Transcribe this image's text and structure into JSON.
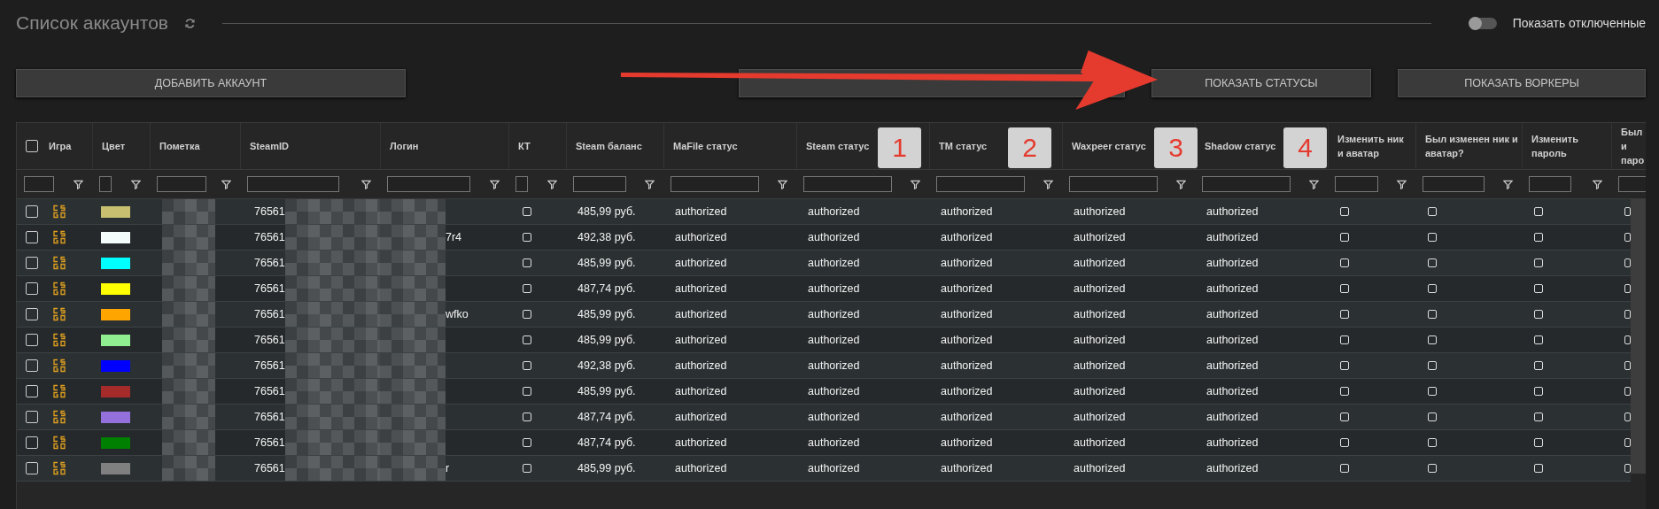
{
  "header": {
    "title": "Список аккаунтов",
    "toggle": {
      "label": "Показать отключенные",
      "on": false
    }
  },
  "buttons": [
    {
      "kind": "text",
      "label": "ДОБАВИТЬ АККАУНТ"
    },
    {
      "kind": "blank"
    },
    {
      "kind": "text",
      "label": "ПОКАЗАТЬ СТАТУСЫ"
    },
    {
      "kind": "text",
      "label": "ПОКАЗАТЬ ВОРКЕРЫ"
    }
  ],
  "table": {
    "all_selected": false,
    "columns": [
      "Игра",
      "Цвет",
      "Пометка",
      "SteamID",
      "Логин",
      "КТ",
      "Steam баланс",
      "MaFile статус",
      "Steam статус",
      "TM статус",
      "Waxpeer статус",
      "Shadow статус",
      "Изменить ник и аватар",
      "Был изменен ник и аватар?",
      "Изменить пароль",
      "Был и паро"
    ],
    "rows": [
      {
        "selected": false,
        "color": "#c8c070",
        "steamid": "76561",
        "kt": false,
        "balance": "485,99 руб.",
        "statuses": [
          "authorized",
          "authorized",
          "authorized",
          "authorized",
          "authorized"
        ],
        "flags": [
          false,
          false,
          false,
          false
        ]
      },
      {
        "selected": false,
        "color": "#f4fbfb",
        "steamid": "76561",
        "login": "7r4",
        "kt": false,
        "balance": "492,38 руб.",
        "statuses": [
          "authorized",
          "authorized",
          "authorized",
          "authorized",
          "authorized"
        ],
        "flags": [
          false,
          false,
          false,
          false
        ]
      },
      {
        "selected": false,
        "color": "#00ffff",
        "steamid": "76561",
        "kt": false,
        "balance": "485,99 руб.",
        "statuses": [
          "authorized",
          "authorized",
          "authorized",
          "authorized",
          "authorized"
        ],
        "flags": [
          false,
          false,
          false,
          false
        ]
      },
      {
        "selected": false,
        "color": "#ffff00",
        "steamid": "76561",
        "kt": false,
        "balance": "487,74 руб.",
        "statuses": [
          "authorized",
          "authorized",
          "authorized",
          "authorized",
          "authorized"
        ],
        "flags": [
          false,
          false,
          false,
          false
        ]
      },
      {
        "selected": false,
        "color": "#ffa500",
        "steamid": "76561",
        "login": "wfko",
        "kt": false,
        "balance": "485,99 руб.",
        "statuses": [
          "authorized",
          "authorized",
          "authorized",
          "authorized",
          "authorized"
        ],
        "flags": [
          false,
          false,
          false,
          false
        ]
      },
      {
        "selected": false,
        "color": "#90ee90",
        "steamid": "76561",
        "kt": false,
        "balance": "485,99 руб.",
        "statuses": [
          "authorized",
          "authorized",
          "authorized",
          "authorized",
          "authorized"
        ],
        "flags": [
          false,
          false,
          false,
          false
        ]
      },
      {
        "selected": false,
        "color": "#0000ff",
        "steamid": "76561",
        "kt": false,
        "balance": "492,38 руб.",
        "statuses": [
          "authorized",
          "authorized",
          "authorized",
          "authorized",
          "authorized"
        ],
        "flags": [
          false,
          false,
          false,
          false
        ]
      },
      {
        "selected": false,
        "color": "#a52a2a",
        "steamid": "76561",
        "kt": false,
        "balance": "485,99 руб.",
        "statuses": [
          "authorized",
          "authorized",
          "authorized",
          "authorized",
          "authorized"
        ],
        "flags": [
          false,
          false,
          false,
          false
        ]
      },
      {
        "selected": false,
        "color": "#9370db",
        "steamid": "76561",
        "kt": false,
        "balance": "487,74 руб.",
        "statuses": [
          "authorized",
          "authorized",
          "authorized",
          "authorized",
          "authorized"
        ],
        "flags": [
          false,
          false,
          false,
          false
        ]
      },
      {
        "selected": false,
        "color": "#008000",
        "steamid": "76561",
        "kt": false,
        "balance": "487,74 руб.",
        "statuses": [
          "authorized",
          "authorized",
          "authorized",
          "authorized",
          "authorized"
        ],
        "flags": [
          false,
          false,
          false,
          false
        ]
      },
      {
        "selected": false,
        "color": "#808080",
        "steamid": "76561",
        "login": "r",
        "kt": false,
        "balance": "485,99 руб.",
        "statuses": [
          "authorized",
          "authorized",
          "authorized",
          "authorized",
          "authorized"
        ],
        "flags": [
          false,
          false,
          false,
          false
        ]
      }
    ]
  },
  "annotations": [
    "1",
    "2",
    "3",
    "4"
  ]
}
